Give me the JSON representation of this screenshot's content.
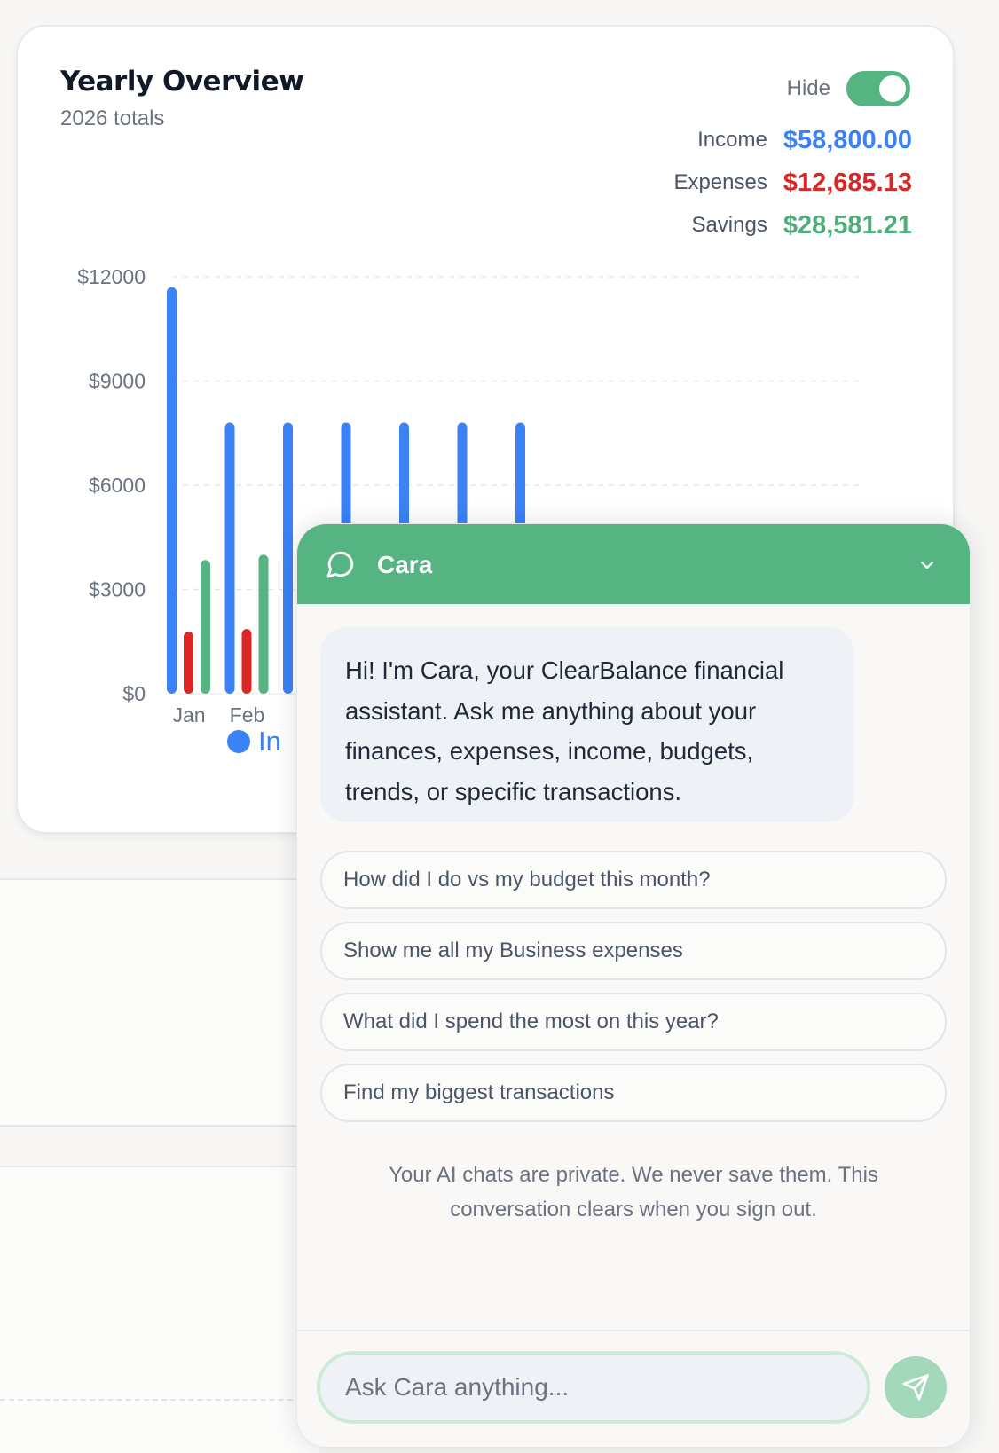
{
  "overview": {
    "title": "Yearly Overview",
    "subtitle": "2026 totals",
    "hide_label": "Hide",
    "hide_toggle_on": true,
    "totals": [
      {
        "label": "Income",
        "value": "$58,800.00",
        "color": "#3b82f6"
      },
      {
        "label": "Expenses",
        "value": "$12,685.13",
        "color": "#dc2626"
      },
      {
        "label": "Savings",
        "value": "$28,581.21",
        "color": "#4fae7c"
      }
    ]
  },
  "chart_data": {
    "type": "bar",
    "yticks": [
      "$12000",
      "$9000",
      "$6000",
      "$3000",
      "$0"
    ],
    "ylim": [
      0,
      12000
    ],
    "grid": true,
    "visible_x_labels": [
      "Jan",
      "Feb"
    ],
    "legend_visible": "In",
    "series": [
      {
        "name": "Income",
        "color": "#3b82f6",
        "values": [
          11700,
          7800,
          7800,
          7800,
          7800,
          7800,
          7800
        ]
      },
      {
        "name": "Expenses",
        "color": "#dc2626",
        "values": [
          1780,
          1860,
          null,
          null,
          null,
          null,
          null
        ]
      },
      {
        "name": "Savings",
        "color": "#55b482",
        "values": [
          3850,
          4000,
          null,
          null,
          null,
          null,
          null
        ]
      }
    ]
  },
  "chat": {
    "title": "Cara",
    "greeting": "Hi! I'm Cara, your ClearBalance financial assistant. Ask me anything about your finances, expenses, income, budgets, trends, or specific transactions.",
    "suggestions": [
      "How did I do vs my budget this month?",
      "Show me all my Business expenses",
      "What did I spend the most on this year?",
      "Find my biggest transactions"
    ],
    "privacy_note": "Your AI chats are private. We never save them. This conversation clears when you sign out.",
    "input_placeholder": "Ask Cara anything...",
    "header_color": "#55b482"
  }
}
